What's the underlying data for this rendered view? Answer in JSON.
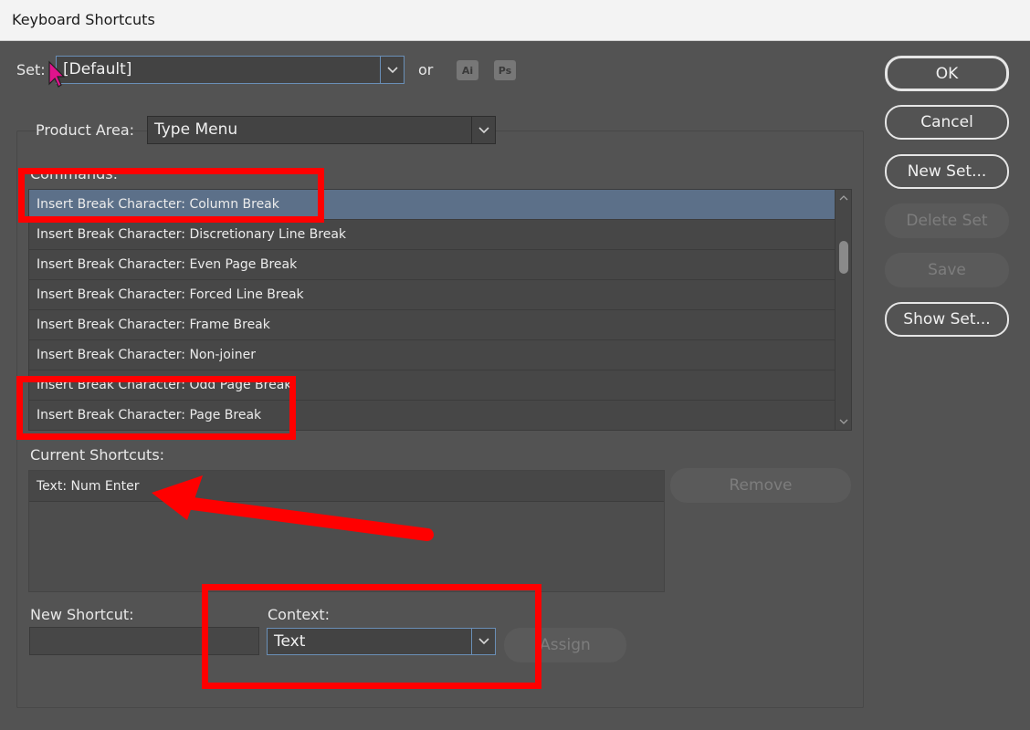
{
  "window": {
    "title": "Keyboard Shortcuts"
  },
  "set": {
    "label": "Set:",
    "value": "[Default]",
    "or": "or",
    "ai": "Ai",
    "ps": "Ps"
  },
  "product_area": {
    "label": "Product Area:",
    "value": "Type Menu"
  },
  "commands": {
    "label": "Commands:",
    "items": [
      "Insert Break Character: Column Break",
      "Insert Break Character: Discretionary Line Break",
      "Insert Break Character: Even Page Break",
      "Insert Break Character: Forced Line Break",
      "Insert Break Character: Frame Break",
      "Insert Break Character: Non-joiner",
      "Insert Break Character: Odd Page Break",
      "Insert Break Character: Page Break"
    ]
  },
  "current_shortcuts": {
    "label": "Current Shortcuts:",
    "items": [
      "Text: Num Enter"
    ],
    "remove": "Remove"
  },
  "new_shortcut": {
    "label": "New Shortcut:",
    "value": ""
  },
  "context": {
    "label": "Context:",
    "value": "Text"
  },
  "assign": "Assign",
  "buttons": {
    "ok": "OK",
    "cancel": "Cancel",
    "new_set": "New Set...",
    "delete_set": "Delete Set",
    "save": "Save",
    "show_set": "Show Set..."
  },
  "colors": {
    "annotation": "#ff0000",
    "selection": "#5c7089",
    "background": "#535353"
  }
}
